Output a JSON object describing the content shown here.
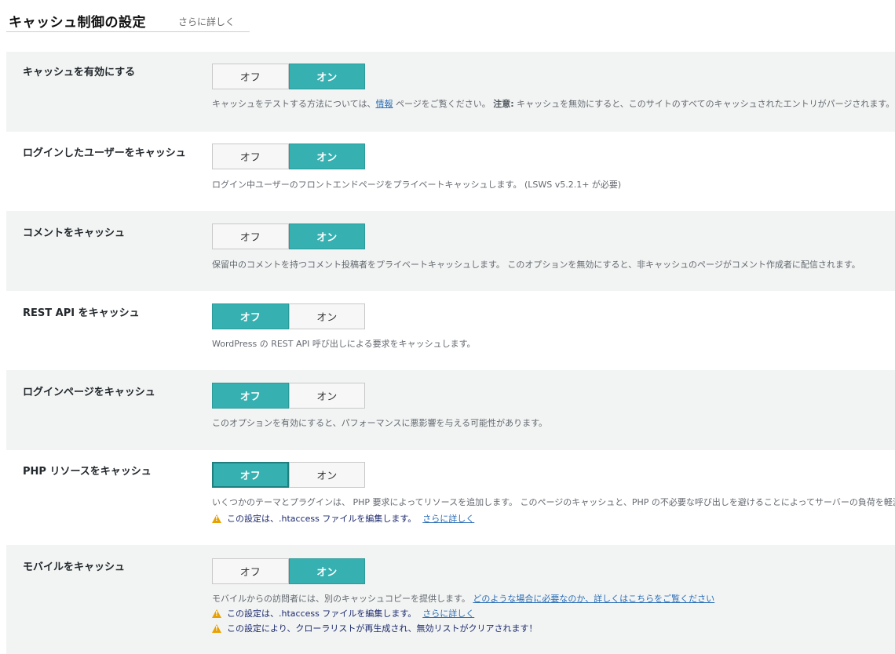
{
  "header": {
    "title": "キャッシュ制御の設定",
    "more_link": "さらに詳しく"
  },
  "toggle_labels": {
    "off": "オフ",
    "on": "オン"
  },
  "settings": [
    {
      "label": "キャッシュを有効にする",
      "state": "on",
      "desc_pre": "キャッシュをテストする方法については、",
      "desc_link": "情報",
      "desc_mid": " ページをご覧ください。",
      "desc_bold": "注意:",
      "desc_post": " キャッシュを無効にすると、このサイトのすべてのキャッシュされたエントリがパージされます。"
    },
    {
      "label": "ログインしたユーザーをキャッシュ",
      "state": "on",
      "desc": "ログイン中ユーザーのフロントエンドページをプライベートキャッシュします。 (LSWS v5.2.1+ が必要)"
    },
    {
      "label": "コメントをキャッシュ",
      "state": "on",
      "desc": "保留中のコメントを持つコメント投稿者をプライベートキャッシュします。 このオプションを無効にすると、非キャッシュのページがコメント作成者に配信されます。"
    },
    {
      "label": "REST API をキャッシュ",
      "state": "off",
      "desc": "WordPress の REST API 呼び出しによる要求をキャッシュします。"
    },
    {
      "label": "ログインページをキャッシュ",
      "state": "off",
      "desc": "このオプションを有効にすると、パフォーマンスに悪影響を与える可能性があります。"
    },
    {
      "label": "PHP リソースをキャッシュ",
      "state": "off",
      "desc": "いくつかのテーマとプラグインは、 PHP 要求によってリソースを追加します。 このページのキャッシュと、PHP の不必要な呼び出しを避けることによってサーバーの負荷を軽減します。",
      "warning": "この設定は、.htaccess ファイルを編集します。",
      "warning_link": "さらに詳しく"
    },
    {
      "label": "モバイルをキャッシュ",
      "state": "on",
      "desc": "モバイルからの訪問者には、別のキャッシュコピーを提供します。",
      "desc_link": "どのような場合に必要なのか、詳しくはこちらをご覧ください",
      "warning": "この設定は、.htaccess ファイルを編集します。",
      "warning_link": "さらに詳しく",
      "warning2": "この設定により、クローラリストが再生成され、無効リストがクリアされます！"
    }
  ]
}
